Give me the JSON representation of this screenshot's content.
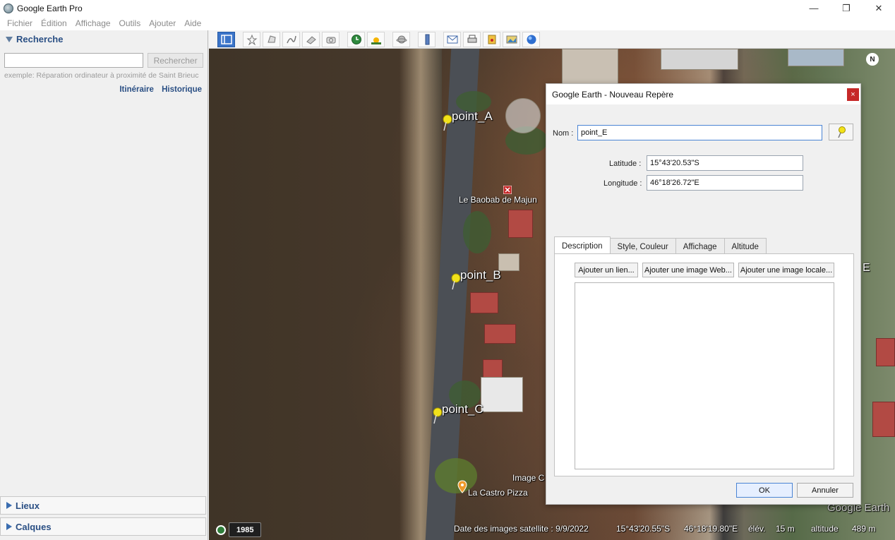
{
  "window": {
    "title": "Google Earth Pro",
    "minimize": "—",
    "restore": "❐",
    "close": "✕"
  },
  "menu": [
    "Fichier",
    "Édition",
    "Affichage",
    "Outils",
    "Ajouter",
    "Aide"
  ],
  "search": {
    "heading": "Recherche",
    "input_value": "",
    "button": "Rechercher",
    "hint": "exemple: Réparation ordinateur à proximité de Saint Brieuc",
    "link_itinerary": "Itinéraire",
    "link_history": "Historique"
  },
  "places": {
    "heading": "Lieux"
  },
  "layers": {
    "heading": "Calques"
  },
  "toolbar": [
    "sidebar-toggle",
    "placemark",
    "polygon",
    "path",
    "image-overlay",
    "record-tour",
    "historical-imagery",
    "sunlight",
    "planets",
    "ruler",
    "email",
    "print",
    "save-image",
    "view-in-maps"
  ],
  "map": {
    "pins": [
      {
        "label": "point_A"
      },
      {
        "label": "point_B"
      },
      {
        "label": "point_C"
      }
    ],
    "poi_baobab": "Le Baobab de Majun",
    "poi_pizza": "La Castro Pizza",
    "poi_image": "Image C",
    "letter_e": "E",
    "compass": "N",
    "watermark": "Google Earth"
  },
  "status": {
    "year": "1985",
    "imagery_date": "Date des images satellite : 9/9/2022",
    "lat": "15°43'20.55\"S",
    "lon": "46°18'19.80\"E",
    "elev_label": "élév.",
    "elev_value": "15 m",
    "alt_label": "altitude",
    "alt_value": "489 m"
  },
  "dialog": {
    "title": "Google Earth - Nouveau Repère",
    "close": "×",
    "name_label": "Nom :",
    "name_value": "point_E",
    "lat_label": "Latitude :",
    "lat_value": "15°43'20.53\"S",
    "lon_label": "Longitude :",
    "lon_value": "46°18'26.72\"E",
    "tabs": [
      "Description",
      "Style, Couleur",
      "Affichage",
      "Altitude"
    ],
    "btn_link": "Ajouter un lien...",
    "btn_web_image": "Ajouter une image Web...",
    "btn_local_image": "Ajouter une image locale...",
    "description_value": "",
    "ok": "OK",
    "cancel": "Annuler"
  },
  "colors": {
    "accent": "#2a4f84",
    "pin": "#f2e21a",
    "close_red": "#c62828"
  }
}
